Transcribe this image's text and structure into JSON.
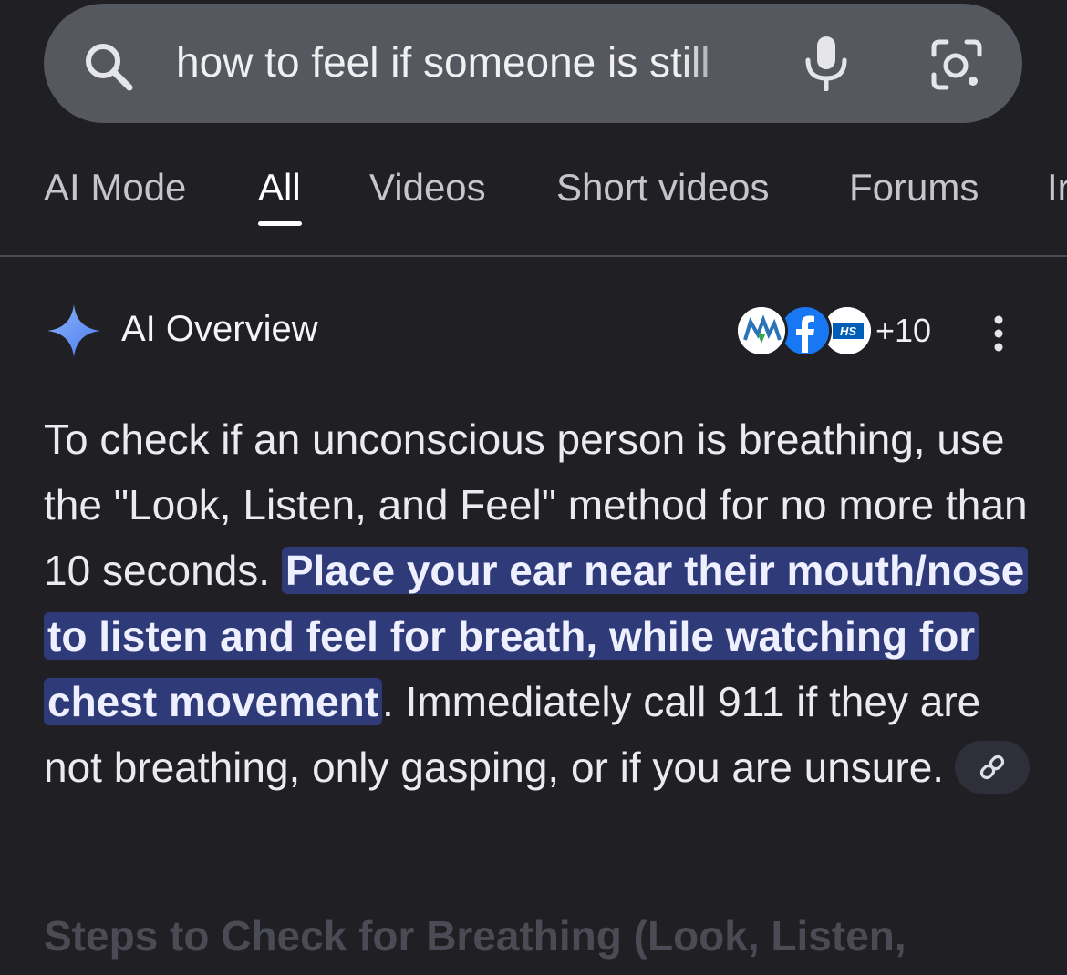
{
  "search": {
    "query": "how to feel if someone is still"
  },
  "tabs": [
    {
      "label": "AI Mode"
    },
    {
      "label": "All"
    },
    {
      "label": "Videos"
    },
    {
      "label": "Short videos"
    },
    {
      "label": "Forums"
    },
    {
      "label": "Ir"
    }
  ],
  "active_tab": "All",
  "overview": {
    "title": "AI Overview",
    "source_more": "+10",
    "sources": [
      "M-logo",
      "facebook-logo",
      "NHS-logo"
    ],
    "text_before": "To check if an unconscious person is breathing, use the \"Look, Listen, and Feel\" method for no more than 10 seconds. ",
    "text_highlight": "Place your ear near their mouth/nose to listen and feel for breath, while watching for chest movement",
    "text_after": ". Immediately call 911 if they are not breathing, only gasping, or if you are unsure.",
    "next_heading": "Steps to Check for Breathing (Look, Listen,"
  },
  "colors": {
    "background": "#1f1f24",
    "search_bar": "#55585e",
    "highlight": "#2f3a78",
    "spark_blue": "#8ab4f8"
  },
  "icons": [
    "search-icon",
    "mic-icon",
    "lens-icon",
    "spark-icon",
    "kebab-menu-icon",
    "link-icon"
  ]
}
